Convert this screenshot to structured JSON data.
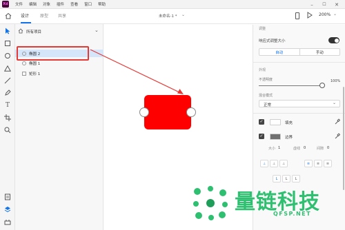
{
  "app": {
    "logo": "Xd"
  },
  "menu": [
    "文件",
    "编辑",
    "对象",
    "插件",
    "查看",
    "窗口",
    "帮助"
  ],
  "toolbar": {
    "tabs": [
      "设计",
      "原型",
      "共享"
    ],
    "doc_title": "未命名-1 *",
    "zoom": "200%"
  },
  "layers": {
    "header": "所有项目",
    "partial_item": "",
    "items": [
      {
        "name": "椭圆 2",
        "selected": true
      },
      {
        "name": "椭圆 1",
        "selected": false
      },
      {
        "name": "矩形 1",
        "selected": false
      }
    ]
  },
  "props": {
    "section_layout": "调整",
    "responsive_label": "响应式调整大小",
    "seg_auto": "自动",
    "seg_manual": "手动",
    "section_appearance": "外观",
    "opacity_label": "不透明度",
    "opacity_value": "100%",
    "blend_label": "混合模式",
    "blend_value": "正常",
    "fill_label": "填充",
    "fill_color": "#ffffff",
    "border_label": "边界",
    "border_color": "#707070",
    "size_label": "大小",
    "size_value": "1",
    "dash_label": "虚线",
    "dash_value": "0",
    "gap_label": "间隙",
    "gap_value": "0"
  },
  "shape": {
    "color": "#ff0000"
  },
  "watermark": {
    "brand": "量链科技",
    "site": "QFSP.NET"
  },
  "colors": {
    "accent": "#1473e6",
    "annotation": "#e53935",
    "shape": "#ff0000"
  }
}
